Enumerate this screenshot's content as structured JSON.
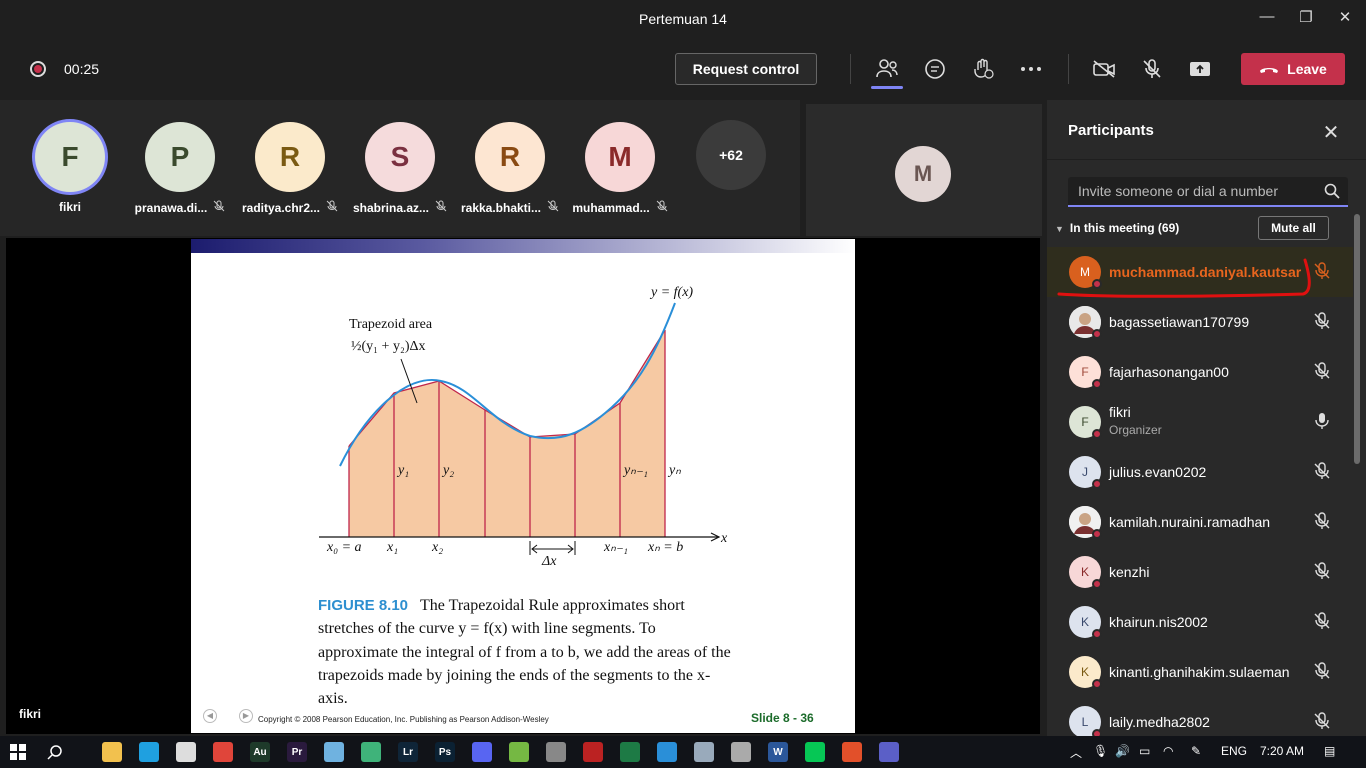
{
  "window": {
    "title": "Pertemuan 14",
    "minimize": "—",
    "maximize": "❐",
    "close": "✕"
  },
  "toolbar": {
    "timer": "00:25",
    "request_control": "Request control",
    "leave": "Leave"
  },
  "tiles": [
    {
      "initial": "F",
      "name": "fikri",
      "bg": "#dde5d6",
      "fg": "#3a4a2d",
      "ring": true,
      "muted": false
    },
    {
      "initial": "P",
      "name": "pranawa.di...",
      "bg": "#dde5d6",
      "fg": "#3a4a2d",
      "ring": false,
      "muted": true
    },
    {
      "initial": "R",
      "name": "raditya.chr2...",
      "bg": "#fbeacb",
      "fg": "#7a5a12",
      "ring": false,
      "muted": true
    },
    {
      "initial": "S",
      "name": "shabrina.az...",
      "bg": "#f5dbdc",
      "fg": "#7a3040",
      "ring": false,
      "muted": true
    },
    {
      "initial": "R",
      "name": "rakka.bhakti...",
      "bg": "#fde6d2",
      "fg": "#8a4a12",
      "ring": false,
      "muted": true
    },
    {
      "initial": "M",
      "name": "muhammad...",
      "bg": "#f7d7d7",
      "fg": "#8a2a2a",
      "ring": false,
      "muted": true
    }
  ],
  "more_count": "+62",
  "side_tile": {
    "initial": "M"
  },
  "presenter": "fikri",
  "slide": {
    "graph": {
      "curve_label": "y = f(x)",
      "area_label": "Trapezoid area",
      "area_formula": "½(y₁ + y₂)Δx",
      "y_labels": [
        "y₁",
        "y₂",
        "yₙ₋₁",
        "yₙ"
      ],
      "x_labels": [
        "x₀ = a",
        "x₁",
        "x₂",
        "Δx",
        "xₙ₋₁",
        "xₙ = b",
        "x"
      ]
    },
    "figure_label": "FIGURE 8.10",
    "caption": "The Trapezoidal Rule approximates short stretches of the curve y = f(x) with line segments. To approximate the integral of f from a to b, we add the areas of the trapezoids made by joining the ends of the segments to the x-axis.",
    "copyright": "Copyright © 2008 Pearson Education, Inc.  Publishing as Pearson Addison-Wesley",
    "slide_number": "Slide  8 - 36"
  },
  "panel": {
    "title": "Participants",
    "invite_placeholder": "Invite someone or dial a number",
    "in_meeting": "In this meeting (69)",
    "mute_all": "Mute all",
    "participants": [
      {
        "initial": "M",
        "name": "muchammad.daniyal.kautsar",
        "role": "",
        "bg": "#d9601e",
        "fg": "#fff",
        "mic": "muted",
        "highlight": true
      },
      {
        "initial": "",
        "name": "bagassetiawan170799",
        "role": "",
        "bg": "#e8e8e8",
        "fg": "#333",
        "mic": "muted",
        "highlight": false,
        "photo": true
      },
      {
        "initial": "F",
        "name": "fajarhasonangan00",
        "role": "",
        "bg": "#fde0d8",
        "fg": "#a04a3a",
        "mic": "muted",
        "highlight": false
      },
      {
        "initial": "F",
        "name": "fikri",
        "role": "Organizer",
        "bg": "#dde5d6",
        "fg": "#3a4a2d",
        "mic": "on",
        "highlight": false
      },
      {
        "initial": "J",
        "name": "julius.evan0202",
        "role": "",
        "bg": "#dde3ee",
        "fg": "#3a4a6d",
        "mic": "muted",
        "highlight": false
      },
      {
        "initial": "",
        "name": "kamilah.nuraini.ramadhan",
        "role": "",
        "bg": "#f0f0f0",
        "fg": "#333",
        "mic": "muted",
        "highlight": false,
        "photo": true
      },
      {
        "initial": "K",
        "name": "kenzhi",
        "role": "",
        "bg": "#f7d7d7",
        "fg": "#8a2a2a",
        "mic": "muted",
        "highlight": false
      },
      {
        "initial": "K",
        "name": "khairun.nis2002",
        "role": "",
        "bg": "#dde3ee",
        "fg": "#3a4a6d",
        "mic": "muted",
        "highlight": false
      },
      {
        "initial": "K",
        "name": "kinanti.ghanihakim.sulaeman",
        "role": "",
        "bg": "#fbeacb",
        "fg": "#7a5a12",
        "mic": "muted",
        "highlight": false
      },
      {
        "initial": "L",
        "name": "laily.medha2802",
        "role": "",
        "bg": "#dde3ee",
        "fg": "#3a4a6d",
        "mic": "muted",
        "highlight": false
      }
    ]
  },
  "taskbar": {
    "apps": [
      {
        "name": "file-explorer-icon",
        "label": "",
        "color": "#f2c14e"
      },
      {
        "name": "edge-icon",
        "label": "",
        "color": "#1fa0e0"
      },
      {
        "name": "store-icon",
        "label": "",
        "color": "#ddd"
      },
      {
        "name": "chrome-icon",
        "label": "",
        "color": "#e0453a"
      },
      {
        "name": "audition-icon",
        "label": "Au",
        "color": "#1e3a2a"
      },
      {
        "name": "premiere-icon",
        "label": "Pr",
        "color": "#2a1a3d"
      },
      {
        "name": "notepad-icon",
        "label": "",
        "color": "#6fb2e0"
      },
      {
        "name": "media-icon",
        "label": "",
        "color": "#3fb37a"
      },
      {
        "name": "lightroom-icon",
        "label": "Lr",
        "color": "#0f2538"
      },
      {
        "name": "photoshop-icon",
        "label": "Ps",
        "color": "#0b2133"
      },
      {
        "name": "discord-icon",
        "label": "",
        "color": "#5865f2"
      },
      {
        "name": "utorrent-icon",
        "label": "",
        "color": "#75b843"
      },
      {
        "name": "steam-icon",
        "label": "",
        "color": "#888"
      },
      {
        "name": "filezilla-icon",
        "label": "",
        "color": "#b22"
      },
      {
        "name": "excel-icon",
        "label": "",
        "color": "#1d7a45"
      },
      {
        "name": "ie-icon",
        "label": "",
        "color": "#2a8fd8"
      },
      {
        "name": "photos-icon",
        "label": "",
        "color": "#9ab"
      },
      {
        "name": "vpn-icon",
        "label": "",
        "color": "#aaa"
      },
      {
        "name": "word-icon",
        "label": "W",
        "color": "#2b579a"
      },
      {
        "name": "line-icon",
        "label": "",
        "color": "#06c755"
      },
      {
        "name": "foxit-icon",
        "label": "",
        "color": "#e2502a"
      },
      {
        "name": "teams-icon",
        "label": "",
        "color": "#5b5fc7"
      }
    ],
    "lang": "ENG",
    "time": "7:20 AM"
  }
}
